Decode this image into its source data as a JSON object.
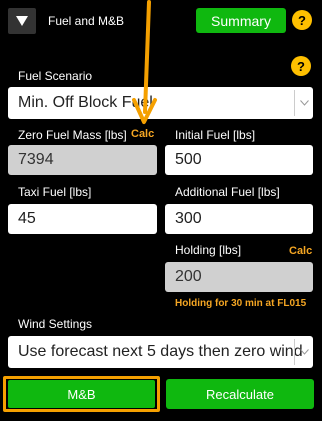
{
  "header": {
    "title": "Fuel and M&B",
    "summary_label": "Summary",
    "help_glyph": "?"
  },
  "fuel_scenario": {
    "label": "Fuel Scenario",
    "help_glyph": "?",
    "selected": "Min. Off Block Fuel"
  },
  "fields": {
    "zfm": {
      "label": "Zero Fuel Mass [lbs]",
      "calc": "Calc",
      "value": "7394"
    },
    "initial_fuel": {
      "label": "Initial Fuel [lbs]",
      "value": "500"
    },
    "taxi_fuel": {
      "label": "Taxi Fuel [lbs]",
      "value": "45"
    },
    "additional_fuel": {
      "label": "Additional Fuel [lbs]",
      "value": "300"
    },
    "holding": {
      "label": "Holding [lbs]",
      "calc": "Calc",
      "value": "200",
      "note": "Holding for 30 min at FL015"
    }
  },
  "wind": {
    "label": "Wind Settings",
    "selected": "Use forecast next 5 days then zero wind"
  },
  "buttons": {
    "mb_label": "M&B",
    "recalc_label": "Recalculate"
  },
  "colors": {
    "accent_green": "#0fb80f",
    "calc_orange": "#f5a623",
    "highlight_orange": "#f5a000",
    "help_yellow": "#ffc000"
  },
  "icons": {
    "header_toggle": "triangle-down-icon",
    "select_chevron": "chevron-down-icon",
    "annotation": "arrow-down-icon"
  }
}
